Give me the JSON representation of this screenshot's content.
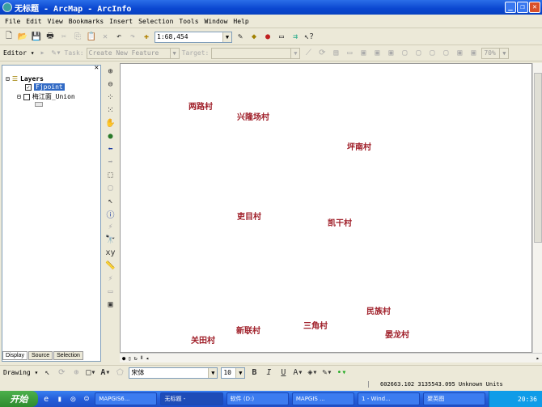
{
  "window": {
    "title": "无标题 - ArcMap - ArcInfo",
    "minimize": "_",
    "restore": "❐",
    "close": "✕"
  },
  "menu": [
    "File",
    "Edit",
    "View",
    "Bookmarks",
    "Insert",
    "Selection",
    "Tools",
    "Window",
    "Help"
  ],
  "standard_toolbar": {
    "scale": "1:68,454"
  },
  "editor_toolbar": {
    "editor_label": "Editor ▾",
    "task_label": "Task:",
    "task_value": "Create New Feature",
    "target_label": "Target:",
    "target_value": "",
    "zoom_value": "70%"
  },
  "toc": {
    "root": "Layers",
    "layers": [
      {
        "name": "Fjpoint",
        "checked": true,
        "selected": true
      },
      {
        "name": "梅江面_Union",
        "checked": false
      }
    ],
    "tabs": [
      "Display",
      "Source",
      "Selection"
    ]
  },
  "map": {
    "label_color": "#a0202a",
    "labels": [
      "两路村",
      "兴隆场村",
      "坪南村",
      "吏目村",
      "凯干村",
      "民族村",
      "三角村",
      "新联村",
      "晏龙村",
      "关田村"
    ]
  },
  "drawing_toolbar": {
    "label": "Drawing ▾",
    "font": "宋体",
    "size": "10",
    "bold": "B",
    "italic": "I",
    "underline": "U"
  },
  "status": {
    "coords": "602663.102  3135543.095 Unknown Units"
  },
  "taskbar": {
    "start": "开始",
    "tasks": [
      "MAPGIS6...",
      "无标题 -",
      "软件 (D:)",
      "MAPGIS ...",
      "1 - Wind...",
      "聚英图"
    ],
    "clock": "20:36"
  }
}
